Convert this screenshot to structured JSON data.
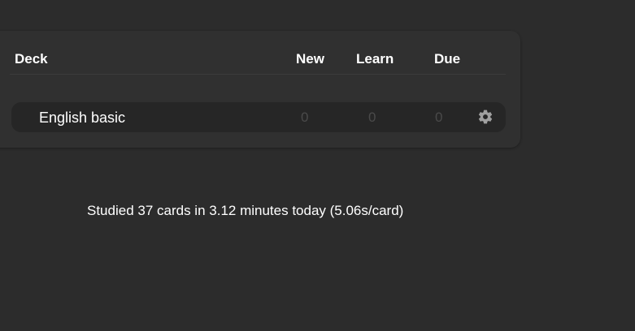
{
  "deck_list": {
    "headers": {
      "deck": "Deck",
      "new": "New",
      "learn": "Learn",
      "due": "Due"
    },
    "decks": [
      {
        "name": "English basic",
        "new": "0",
        "learn": "0",
        "due": "0",
        "options_icon": "gear-icon"
      }
    ]
  },
  "stats": {
    "summary": "Studied 37 cards in 3.12 minutes today (5.06s/card)"
  },
  "colors": {
    "background": "#2c2c2c",
    "panel": "#303030",
    "row": "#262626",
    "zero_count": "#4a4a4a",
    "gear": "#a0a0a0"
  }
}
